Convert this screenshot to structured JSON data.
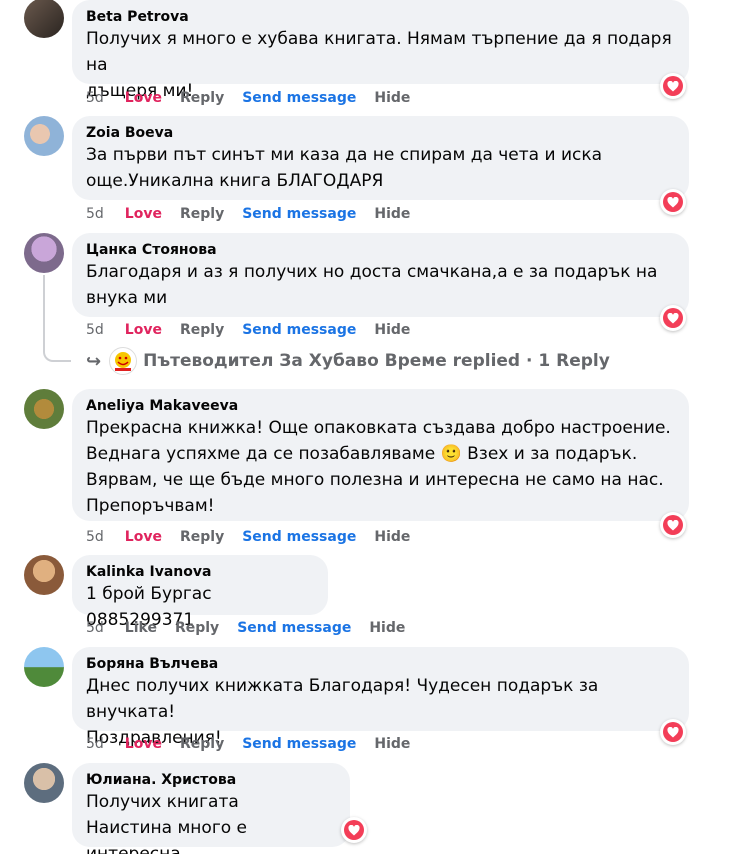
{
  "colors": {
    "love": "#e0245e",
    "send": "#1b74e4",
    "bubble": "#f0f2f5",
    "heart": "#f33e58"
  },
  "actions": {
    "love": "Love",
    "like": "Like",
    "reply": "Reply",
    "send": "Send message",
    "hide": "Hide"
  },
  "comments": [
    {
      "author": "Beta Petrova",
      "text": "Получих я много е хубава книгата. Нямам търпение да я подаря на\nдъщеря ми!",
      "time": "5d",
      "reaction": "Love"
    },
    {
      "author": "Zoia Boeva",
      "text": "За първи път синът ми каза да не спирам да чета и иска\nоще.Уникална книга БЛАГОДАРЯ",
      "time": "5d",
      "reaction": "Love"
    },
    {
      "author": "Цанка Стоянова",
      "text": "Благодаря и аз я получих но доста смачкана,а е за подарък на\nвнука ми",
      "time": "5d",
      "reaction": "Love"
    },
    {
      "author": "Aneliya Makaveeva",
      "text": "Прекрасна книжка! Още опаковката създава добро настроение.\nВеднага успяхме да се позабавляваме 🙂 Взех и за подарък.\nВярвам, че ще бъде много полезна и интересна не само на нас.\nПрепоръчвам!",
      "time": "5d",
      "reaction": "Love"
    },
    {
      "author": "Kalinka Ivanova",
      "text": "1 брой Бургас 0885299371",
      "time": "5d",
      "reaction": "Like"
    },
    {
      "author": "Боряна Вълчева",
      "text": "Днес получих книжката Благодаря! Чудесен подарък за внучката!\nПоздравления!",
      "time": "5d",
      "reaction": "Love"
    },
    {
      "author": "Юлиана. Христова",
      "text": "Получих книгата\nНаистина много е интересна",
      "time": "",
      "reaction": ""
    }
  ],
  "reply_summary": {
    "page": "Пътеводител За Хубаво Време",
    "text": "Пътеводител За Хубаво Време replied · 1 Reply"
  }
}
